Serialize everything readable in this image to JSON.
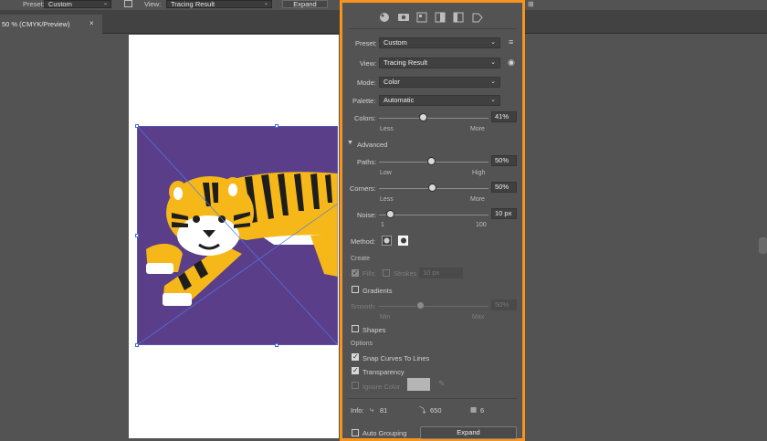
{
  "topbar": {
    "preset_label": "Preset:",
    "preset_value": "Custom",
    "view_label": "View:",
    "view_value": "Tracing Result",
    "expand_label": "Expand"
  },
  "document": {
    "tab_title": "50 % (CMYK/Preview)",
    "close_glyph": "×"
  },
  "panel": {
    "preset": {
      "label": "Preset:",
      "value": "Custom"
    },
    "view": {
      "label": "View:",
      "value": "Tracing Result"
    },
    "mode": {
      "label": "Mode:",
      "value": "Color"
    },
    "palette": {
      "label": "Palette:",
      "value": "Automatic"
    },
    "colors": {
      "label": "Colors:",
      "value": "41%",
      "level": 0.41,
      "min_label": "Less",
      "max_label": "More"
    },
    "advanced_label": "Advanced",
    "paths": {
      "label": "Paths:",
      "value": "50%",
      "level": 0.5,
      "min_label": "Low",
      "max_label": "High"
    },
    "corners": {
      "label": "Corners:",
      "value": "50%",
      "level": 0.5,
      "min_label": "Less",
      "max_label": "More"
    },
    "noise": {
      "label": "Noise:",
      "value": "10 px",
      "level": 0.09,
      "min_label": "1",
      "max_label": "100"
    },
    "method_label": "Method:",
    "create_label": "Create",
    "fills_label": "Fills",
    "strokes_label": "Strokes",
    "stroke_value": "10 px",
    "gradients_label": "Gradients",
    "smooth_label": "Smooth:",
    "smooth_value": "50%",
    "smooth_min": "Min",
    "smooth_max": "Max",
    "shapes_label": "Shapes",
    "options_label": "Options",
    "snap_label": "Snap Curves To Lines",
    "transparency_label": "Transparency",
    "ignore_color_label": "Ignore Color",
    "info_label": "Info:",
    "info_paths": "81",
    "info_anchors": "650",
    "info_colors": "6",
    "auto_grouping_label": "Auto Grouping",
    "expand_label": "Expand"
  },
  "colors": {
    "accent": "#f7941d",
    "art_bg": "#5b3e8a",
    "tiger_yellow": "#f6b818"
  }
}
